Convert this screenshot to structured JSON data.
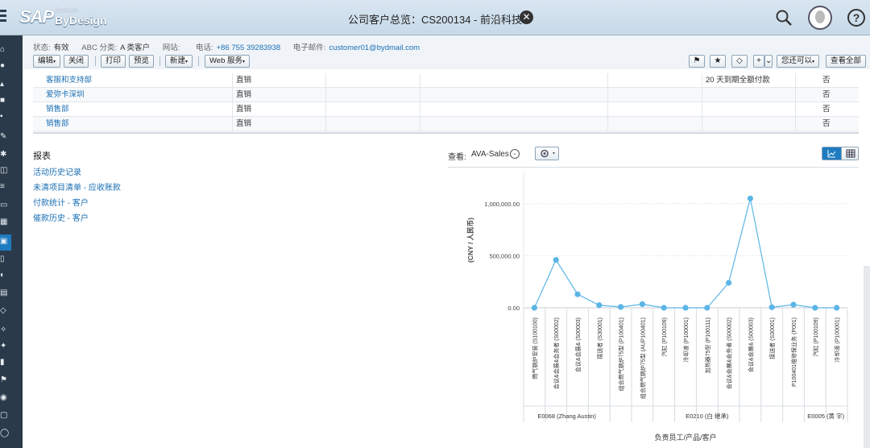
{
  "header": {
    "logo_sap": "SAP",
    "logo_business": "Business",
    "logo_bydesign": "ByDesign",
    "title": "公司客户总览：CS200134 - 前沿科技",
    "close_glyph": "✕",
    "help_glyph": "?"
  },
  "info": {
    "status_label": "状态:",
    "status_value": "有效",
    "abc_label": "ABC 分类:",
    "abc_value": "A 类客户",
    "website_label": "网站:",
    "website_value": "",
    "phone_label": "电话:",
    "phone_value": "+86 755 39283938",
    "email_label": "电子邮件:",
    "email_value": "customer01@bydmail.com"
  },
  "toolbar": {
    "edit": "编辑",
    "close": "关闭",
    "print": "打印",
    "preview": "预览",
    "new": "新建",
    "web_services": "Web 服务",
    "you_can": "您还可以",
    "view_all": "查看全部"
  },
  "table": {
    "rows": [
      {
        "name": "客服和支持部",
        "channel": "直销",
        "payment": "20 天到期全额付款",
        "flag": "否"
      },
      {
        "name": "爱弥卡深圳",
        "channel": "直销",
        "payment": "",
        "flag": "否"
      },
      {
        "name": "销售部",
        "channel": "直销",
        "payment": "",
        "flag": "否"
      },
      {
        "name": "销售部",
        "channel": "直销",
        "payment": "",
        "flag": "否"
      }
    ]
  },
  "reports": {
    "title": "报表",
    "items": [
      "活动历史记录",
      "未清项目清单 - 应收账款",
      "付款统计 - 客户",
      "催款历史 - 客户"
    ]
  },
  "chart_panel": {
    "view_label": "查看:",
    "view_value": "AVA-Sales"
  },
  "chart_data": {
    "type": "line",
    "ylabel": "(CNY / 人民币)",
    "xlabel": "负责员工/产品/客户",
    "ylim": [
      0,
      1300000
    ],
    "yticks": [
      0,
      500000,
      1000000
    ],
    "ytick_labels": [
      "0.00",
      "500,000.00",
      "1,000,000.00"
    ],
    "grid": true,
    "categories": [
      "燃气锅炉安装 (S100100)",
      "会议&会展&会务者 (S00002)",
      "会议&会展& (S00003)",
      "接送者 (S30001)",
      "组合燃气锅炉75型 (P100401)",
      "组合燃气锅炉75型 (AUP100401)",
      "汽缸 (P100109)",
      "冷却液 (P100001)",
      "加热器75型 (P100111)",
      "会议&会展&会务者 (S00002)",
      "会议&会展& (S00003)",
      "接送者 (S30001)",
      "P100401维修保业务 (P001)",
      "汽缸 (P100109)",
      "冷却液 (P100001)"
    ],
    "groups": [
      {
        "label": "E0068 (Zhang Austin)",
        "start": 0,
        "end": 3
      },
      {
        "label": "E0210 (白 继承)",
        "start": 4,
        "end": 12
      },
      {
        "label": "E0005 (黄 宇)",
        "start": 13,
        "end": 14
      }
    ],
    "values": [
      0,
      460000,
      130000,
      25000,
      8000,
      35000,
      0,
      0,
      0,
      240000,
      1050000,
      5000,
      30000,
      0,
      0
    ],
    "color": "#5bb5e6"
  }
}
